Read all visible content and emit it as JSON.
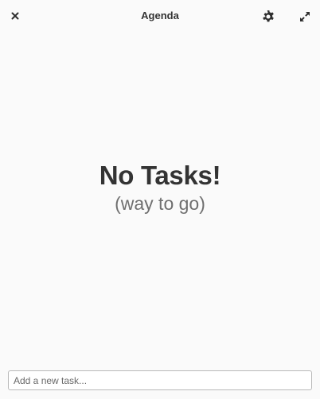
{
  "window": {
    "title": "Agenda"
  },
  "empty_state": {
    "title": "No Tasks!",
    "subtitle": "(way to go)"
  },
  "new_task": {
    "placeholder": "Add a new task...",
    "value": ""
  },
  "icons": {
    "close": "close-icon",
    "settings": "gear-icon",
    "maximize": "maximize-icon"
  },
  "colors": {
    "background": "#fafafa",
    "text": "#333333",
    "subtitle": "#6f6f6f",
    "input_border": "#b9b9b9"
  }
}
